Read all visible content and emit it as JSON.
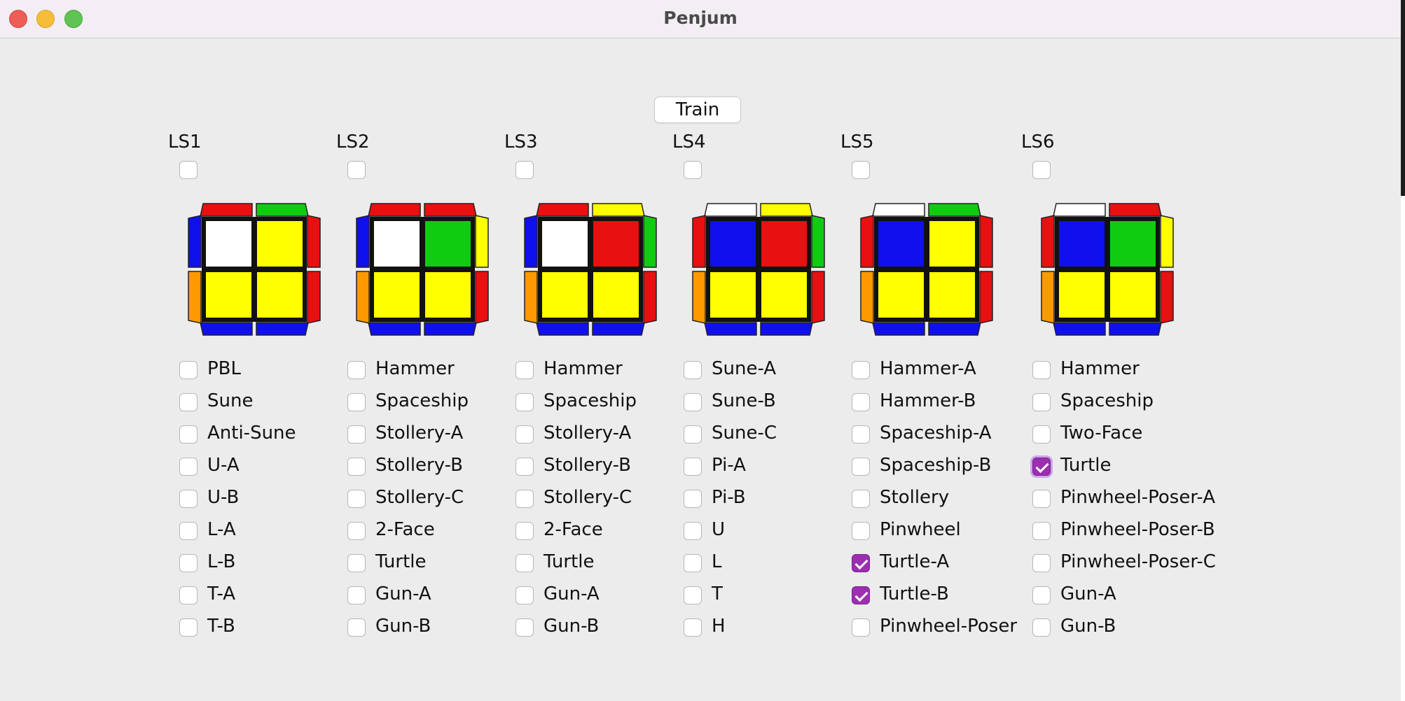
{
  "window": {
    "title": "Penjum"
  },
  "train_label": "Train",
  "colors": {
    "W": "#ffffff",
    "Y": "#ffff00",
    "R": "#e81010",
    "G": "#10cc10",
    "B": "#1010ee",
    "O": "#ff9900",
    "checked": "#9b2fb0"
  },
  "columns": [
    {
      "label": "LS1",
      "checked": false,
      "cube": {
        "top": [
          "R",
          "G"
        ],
        "left": [
          "B",
          "O"
        ],
        "right": [
          "R",
          "R"
        ],
        "bottom": [
          "B",
          "B"
        ],
        "face": [
          "W",
          "Y",
          "Y",
          "Y"
        ]
      },
      "items": [
        {
          "label": "PBL",
          "checked": false
        },
        {
          "label": "Sune",
          "checked": false
        },
        {
          "label": "Anti-Sune",
          "checked": false
        },
        {
          "label": "U-A",
          "checked": false
        },
        {
          "label": "U-B",
          "checked": false
        },
        {
          "label": "L-A",
          "checked": false
        },
        {
          "label": "L-B",
          "checked": false
        },
        {
          "label": "T-A",
          "checked": false
        },
        {
          "label": "T-B",
          "checked": false
        }
      ]
    },
    {
      "label": "LS2",
      "checked": false,
      "cube": {
        "top": [
          "R",
          "R"
        ],
        "left": [
          "B",
          "O"
        ],
        "right": [
          "Y",
          "R"
        ],
        "bottom": [
          "B",
          "B"
        ],
        "face": [
          "W",
          "G",
          "Y",
          "Y"
        ]
      },
      "items": [
        {
          "label": "Hammer",
          "checked": false
        },
        {
          "label": "Spaceship",
          "checked": false
        },
        {
          "label": "Stollery-A",
          "checked": false
        },
        {
          "label": "Stollery-B",
          "checked": false
        },
        {
          "label": "Stollery-C",
          "checked": false
        },
        {
          "label": "2-Face",
          "checked": false
        },
        {
          "label": "Turtle",
          "checked": false
        },
        {
          "label": "Gun-A",
          "checked": false
        },
        {
          "label": "Gun-B",
          "checked": false
        }
      ]
    },
    {
      "label": "LS3",
      "checked": false,
      "cube": {
        "top": [
          "R",
          "Y"
        ],
        "left": [
          "B",
          "O"
        ],
        "right": [
          "G",
          "R"
        ],
        "bottom": [
          "B",
          "B"
        ],
        "face": [
          "W",
          "R",
          "Y",
          "Y"
        ]
      },
      "items": [
        {
          "label": "Hammer",
          "checked": false
        },
        {
          "label": "Spaceship",
          "checked": false
        },
        {
          "label": "Stollery-A",
          "checked": false
        },
        {
          "label": "Stollery-B",
          "checked": false
        },
        {
          "label": "Stollery-C",
          "checked": false
        },
        {
          "label": "2-Face",
          "checked": false
        },
        {
          "label": "Turtle",
          "checked": false
        },
        {
          "label": "Gun-A",
          "checked": false
        },
        {
          "label": "Gun-B",
          "checked": false
        }
      ]
    },
    {
      "label": "LS4",
      "checked": false,
      "cube": {
        "top": [
          "W",
          "Y"
        ],
        "left": [
          "R",
          "O"
        ],
        "right": [
          "G",
          "R"
        ],
        "bottom": [
          "B",
          "B"
        ],
        "face": [
          "B",
          "R",
          "Y",
          "Y"
        ]
      },
      "items": [
        {
          "label": "Sune-A",
          "checked": false
        },
        {
          "label": "Sune-B",
          "checked": false
        },
        {
          "label": "Sune-C",
          "checked": false
        },
        {
          "label": "Pi-A",
          "checked": false
        },
        {
          "label": "Pi-B",
          "checked": false
        },
        {
          "label": "U",
          "checked": false
        },
        {
          "label": "L",
          "checked": false
        },
        {
          "label": "T",
          "checked": false
        },
        {
          "label": "H",
          "checked": false
        }
      ]
    },
    {
      "label": "LS5",
      "checked": false,
      "cube": {
        "top": [
          "W",
          "G"
        ],
        "left": [
          "R",
          "O"
        ],
        "right": [
          "R",
          "R"
        ],
        "bottom": [
          "B",
          "B"
        ],
        "face": [
          "B",
          "Y",
          "Y",
          "Y"
        ]
      },
      "items": [
        {
          "label": "Hammer-A",
          "checked": false
        },
        {
          "label": "Hammer-B",
          "checked": false
        },
        {
          "label": "Spaceship-A",
          "checked": false
        },
        {
          "label": "Spaceship-B",
          "checked": false
        },
        {
          "label": "Stollery",
          "checked": false
        },
        {
          "label": "Pinwheel",
          "checked": false
        },
        {
          "label": "Turtle-A",
          "checked": true
        },
        {
          "label": "Turtle-B",
          "checked": true
        },
        {
          "label": "Pinwheel-Poser",
          "checked": false
        }
      ]
    },
    {
      "label": "LS6",
      "checked": false,
      "cube": {
        "top": [
          "W",
          "R"
        ],
        "left": [
          "R",
          "O"
        ],
        "right": [
          "Y",
          "R"
        ],
        "bottom": [
          "B",
          "B"
        ],
        "face": [
          "B",
          "G",
          "Y",
          "Y"
        ]
      },
      "items": [
        {
          "label": "Hammer",
          "checked": false
        },
        {
          "label": "Spaceship",
          "checked": false
        },
        {
          "label": "Two-Face",
          "checked": false
        },
        {
          "label": "Turtle",
          "checked": true
        },
        {
          "label": "Pinwheel-Poser-A",
          "checked": false
        },
        {
          "label": "Pinwheel-Poser-B",
          "checked": false
        },
        {
          "label": "Pinwheel-Poser-C",
          "checked": false
        },
        {
          "label": "Gun-A",
          "checked": false
        },
        {
          "label": "Gun-B",
          "checked": false
        }
      ]
    }
  ]
}
